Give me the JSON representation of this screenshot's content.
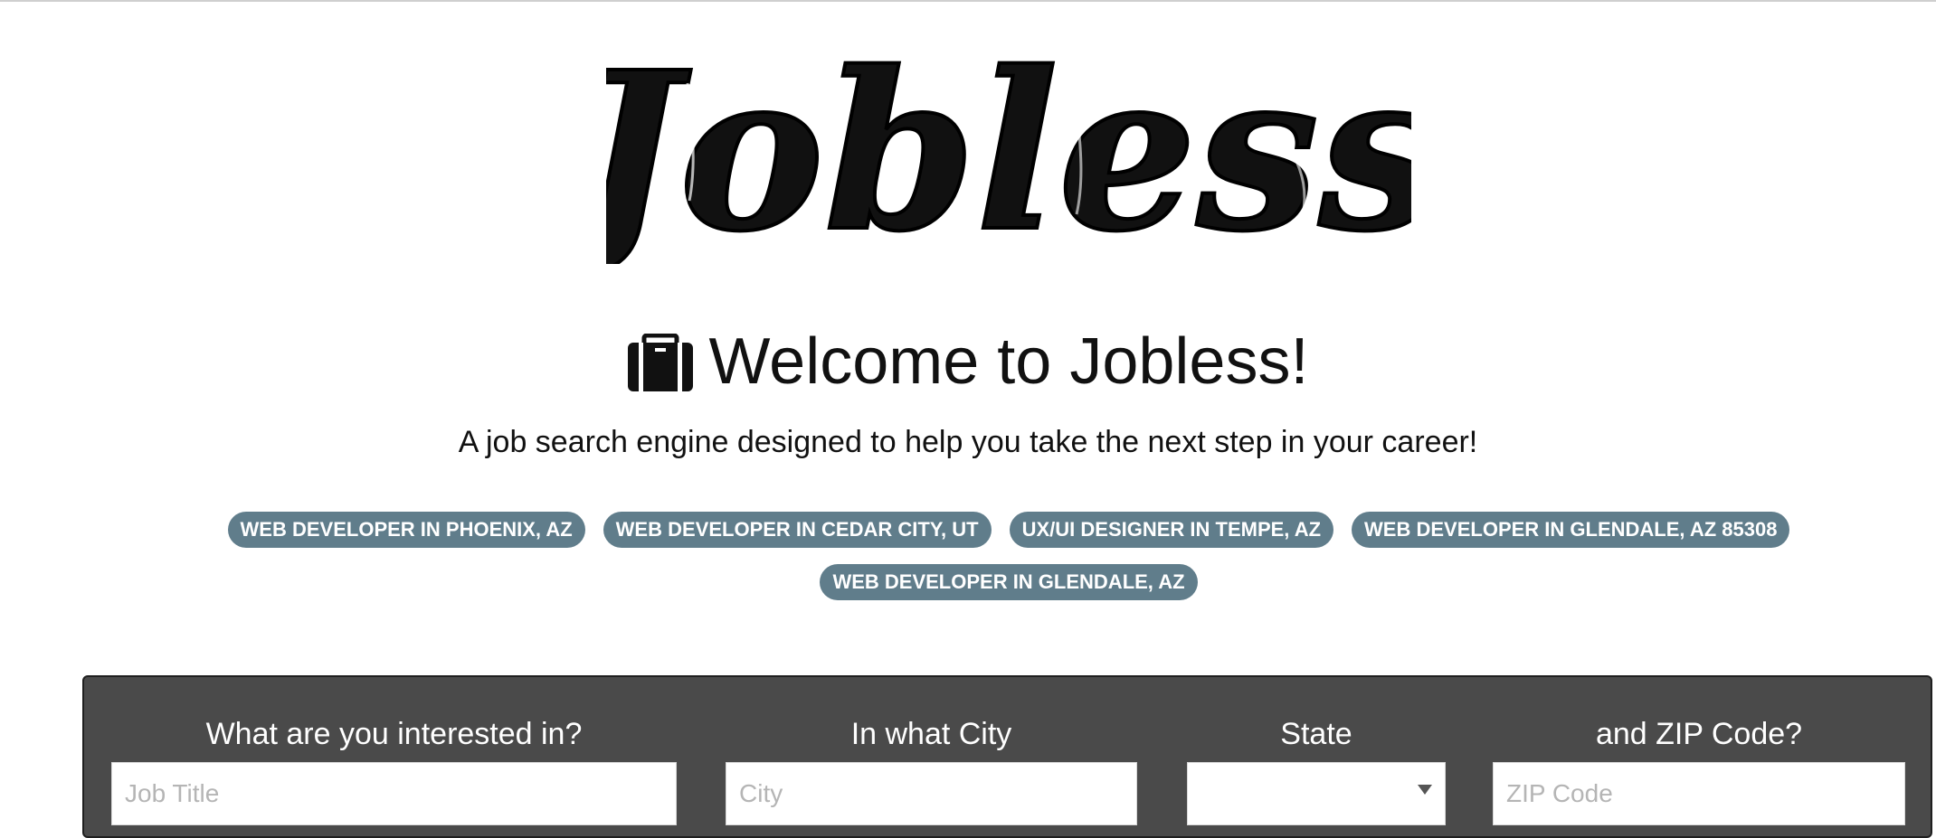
{
  "logo": {
    "text": "Jobless"
  },
  "welcome": {
    "icon": "briefcase-icon",
    "title": "Welcome to Jobless!"
  },
  "subtitle": "A job search engine designed to help you take the next step in your career!",
  "recent_searches": [
    "WEB DEVELOPER IN PHOENIX, AZ",
    "WEB DEVELOPER IN CEDAR CITY, UT",
    "UX/UI DESIGNER IN TEMPE, AZ",
    "WEB DEVELOPER IN GLENDALE, AZ 85308",
    "WEB DEVELOPER IN GLENDALE, AZ"
  ],
  "search": {
    "job_label": "What are you interested in?",
    "job_placeholder": "Job Title",
    "city_label": "In what City",
    "city_placeholder": "City",
    "state_label": "State",
    "state_value": "",
    "zip_label": "and ZIP Code?",
    "zip_placeholder": "ZIP Code"
  },
  "colors": {
    "chip_bg": "#607d8b",
    "panel_bg": "#4a4a4a"
  }
}
